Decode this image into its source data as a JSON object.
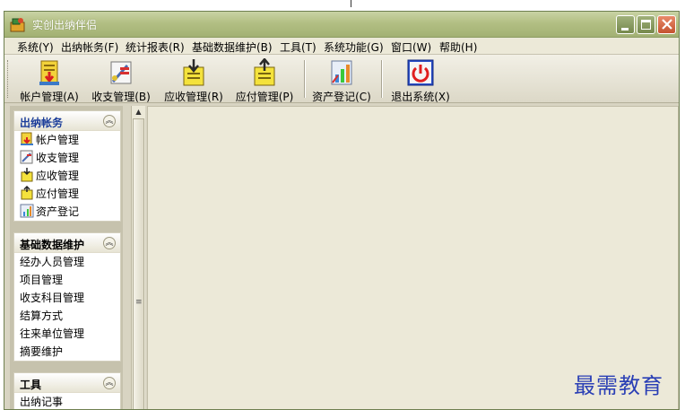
{
  "window": {
    "title": "实创出纳伴侣"
  },
  "menubar": {
    "items": [
      "系统(Y)",
      "出纳帐务(F)",
      "统计报表(R)",
      "基础数据维护(B)",
      "工具(T)",
      "系统功能(G)",
      "窗口(W)",
      "帮助(H)"
    ]
  },
  "toolbar": {
    "buttons": [
      {
        "label": "帐户管理(A)",
        "icon": "account-ledger-icon"
      },
      {
        "label": "收支管理(B)",
        "icon": "income-expense-icon"
      },
      {
        "label": "应收管理(R)",
        "icon": "receivable-icon"
      },
      {
        "label": "应付管理(P)",
        "icon": "payable-icon"
      },
      {
        "label": "资产登记(C)",
        "icon": "asset-register-icon"
      },
      {
        "label": "退出系统(X)",
        "icon": "power-icon"
      }
    ]
  },
  "sidebar": {
    "sections": [
      {
        "title": "出纳帐务",
        "items": [
          "帐户管理",
          "收支管理",
          "应收管理",
          "应付管理",
          "资产登记"
        ]
      },
      {
        "title": "基础数据维护",
        "items": [
          "经办人员管理",
          "项目管理",
          "收支科目管理",
          "结算方式",
          "往来单位管理",
          "摘要维护"
        ]
      },
      {
        "title": "工具",
        "items": [
          "出纳记事"
        ]
      }
    ]
  },
  "watermark": {
    "text": "最需教育"
  },
  "colors": {
    "titlebar": "#b2bf83",
    "accent_blue": "#1b3d9a",
    "close_button": "#c4522f"
  }
}
